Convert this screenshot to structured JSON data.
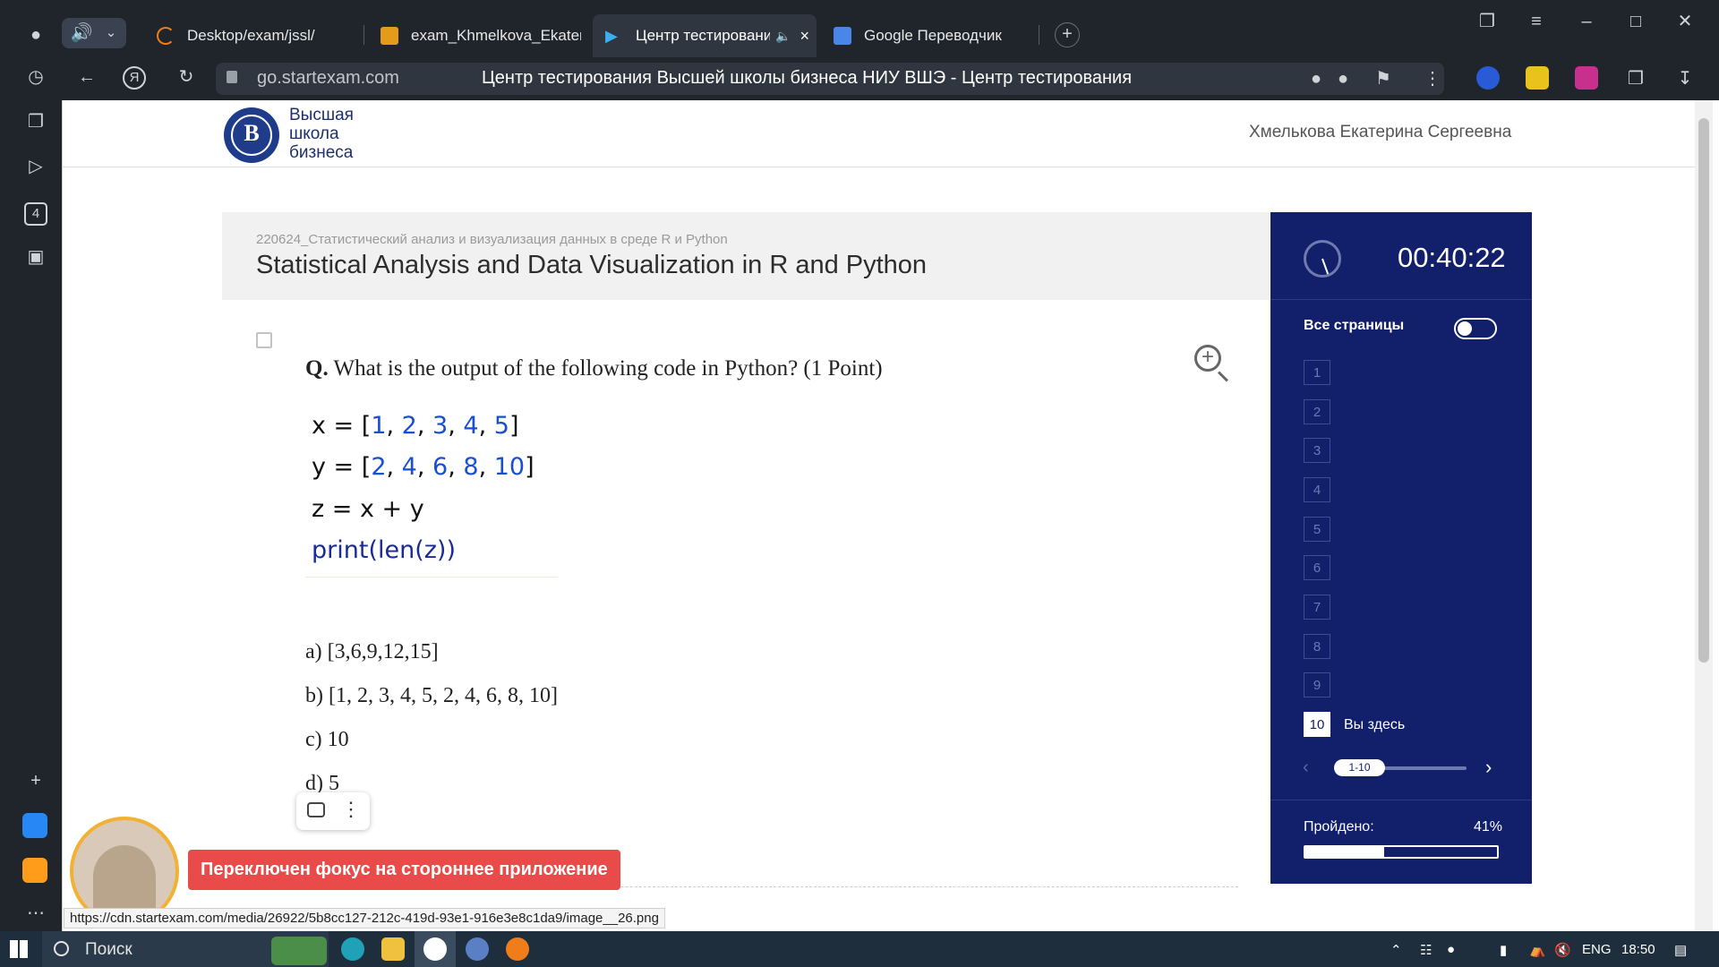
{
  "browser": {
    "tabs": [
      {
        "label": "Desktop/exam/jssl/"
      },
      {
        "label": "exam_Khmelkova_Ekaterina"
      },
      {
        "label": "Центр тестировани"
      },
      {
        "label": "Google Переводчик"
      }
    ],
    "url": "go.startexam.com",
    "page_title": "Центр тестирования Высшей школы бизнеса НИУ ВШЭ - Центр тестирования",
    "left_badge": "4",
    "status_url": "https://cdn.startexam.com/media/26922/5b8cc127-212c-419d-93e1-916e3e8c1da9/image__26.png"
  },
  "site": {
    "logo_lines": [
      "Высшая",
      "школа",
      "бизнеса"
    ],
    "student_name": "Хмелькова Екатерина Сергеевна"
  },
  "exam": {
    "course_code": "220624_Статистический анализ и визуализация данных в среде R и Python",
    "course_title": "Statistical Analysis and Data Visualization in R and Python",
    "question_prefix": "Q.",
    "question": "What is the output of the following code in Python? (1 Point)",
    "code": {
      "x_line": "x = [1, 2, 3, 4, 5]",
      "y_line": "y = [2, 4, 6, 8, 10]",
      "z_line": "z = x + y",
      "print_line": "print(len(z))"
    },
    "answers": [
      "a) [3,6,9,12,15]",
      "b) [1, 2, 3, 4, 5, 2, 4, 6, 8, 10]",
      "c) 10",
      "d) 5"
    ]
  },
  "panel": {
    "timer": "00:40:22",
    "all_pages_label": "Все страницы",
    "pages": [
      "1",
      "2",
      "3",
      "4",
      "5",
      "6",
      "7",
      "8",
      "9",
      "10"
    ],
    "current_page": "10",
    "you_here": "Вы здесь",
    "pager_range": "1-10",
    "passed_label": "Пройдено:",
    "passed_pct": "41%",
    "passed_fraction": 0.41
  },
  "alert": "Переключен фокус на стороннее приложение",
  "taskbar": {
    "search": "Поиск",
    "lang": "ENG",
    "time": "18:50"
  },
  "colors": {
    "panel": "#12206b",
    "alert": "#e94b4b",
    "code_number": "#1a4fd1"
  }
}
